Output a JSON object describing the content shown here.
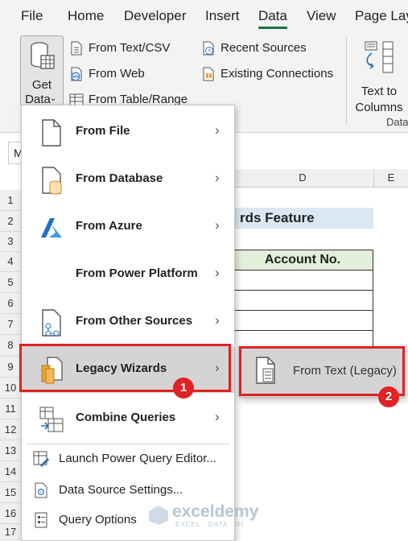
{
  "tabs": [
    "File",
    "Home",
    "Developer",
    "Insert",
    "Data",
    "View",
    "Page Lay"
  ],
  "ribbon": {
    "get_data": [
      "Get",
      "Data"
    ],
    "from_text_csv": "From Text/CSV",
    "from_web": "From Web",
    "from_table_range": "From Table/Range",
    "recent_sources": "Recent Sources",
    "existing_connections": "Existing Connections",
    "text_to_columns": [
      "Text to",
      "Columns"
    ],
    "group_label": "Data"
  },
  "sheet": {
    "name_box": "M",
    "col_d": "D",
    "col_e": "E",
    "rows": [
      "1",
      "2",
      "3",
      "4",
      "5",
      "6",
      "7",
      "8",
      "9",
      "10",
      "11",
      "12",
      "13",
      "14",
      "15",
      "16",
      "17"
    ],
    "title_fragment": "rds Feature",
    "header": "Account No."
  },
  "menu": {
    "items": [
      {
        "label": "From File",
        "icon": "file-icon"
      },
      {
        "label": "From Database",
        "icon": "database-file-icon"
      },
      {
        "label": "From Azure",
        "icon": "azure-icon"
      },
      {
        "label": "From Power Platform",
        "icon": "power-platform-icon"
      },
      {
        "label": "From Other Sources",
        "icon": "other-sources-icon"
      },
      {
        "label": "Legacy Wizards",
        "icon": "legacy-wizards-icon"
      },
      {
        "label": "Combine Queries",
        "icon": "combine-queries-icon"
      }
    ],
    "bottom_items": [
      {
        "label": "Launch Power Query Editor...",
        "icon": "power-query-editor-icon"
      },
      {
        "label": "Data Source Settings...",
        "icon": "data-source-settings-icon"
      },
      {
        "label": "Query Options",
        "icon": "query-options-icon"
      }
    ]
  },
  "submenu": {
    "label": "From Text (Legacy)"
  },
  "badges": [
    "1",
    "2"
  ],
  "watermark": {
    "name": "exceldemy",
    "tagline": "EXCEL · DATA · BI"
  },
  "colors": {
    "accent": "#1e7145",
    "highlight": "#e02222"
  }
}
